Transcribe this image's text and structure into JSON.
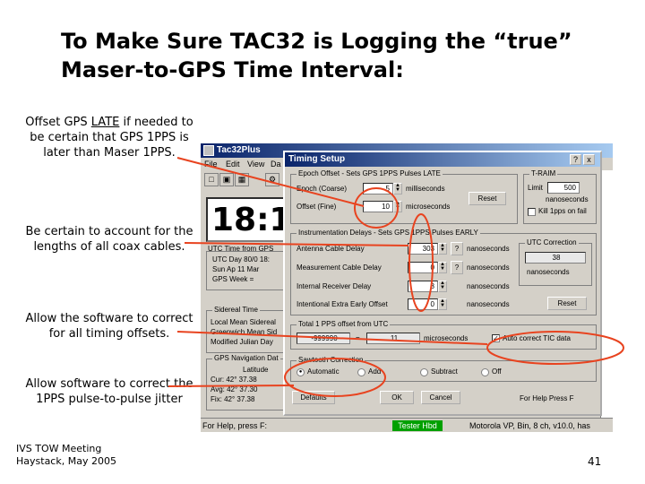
{
  "slide": {
    "title_line1": "To Make Sure TAC32 is Logging the “true”",
    "title_line2": "Maser-to-GPS Time Interval:",
    "note1": {
      "before": "Offset GPS ",
      "underlined": "LATE",
      "after": " if needed to be certain that GPS 1PPS is later than Maser 1PPS."
    },
    "note2": "Be certain to account for the lengths of all coax cables.",
    "note3": "Allow the software to correct for all timing offsets.",
    "note4": "Allow software to correct the 1PPS pulse-to-pulse jitter",
    "footer_line1": "IVS TOW Meeting",
    "footer_line2": "Haystack, May 2005",
    "page_number": "41"
  },
  "app": {
    "title": "Tac32Plus",
    "menu": [
      "File",
      "Edit",
      "View",
      "Da"
    ],
    "clock": "18:1",
    "utc_label": "UTC Time from GPS",
    "utc_lines": [
      "UTC Day 80/0 18:",
      "Sun Ap 11 Mar",
      "GPS Week ="
    ],
    "sidereal_title": "Sidereal Time",
    "sidereal_lines": [
      "Local Mean Sidereal",
      "Greenwich Mean Sid",
      "Modified Julian Day"
    ],
    "gps_nav_title": "GPS Navigation Dat",
    "gps_nav_lines": [
      "Latitude",
      "Cur:   42° 37.38",
      "Avg:   42° 37.30",
      "Fix:   42° 37.38"
    ],
    "status_help": "For Help, press F:",
    "status_green": "Tester Hbd",
    "status_right": "Motorola VP, Bin, 8 ch, v10.0, has",
    "icons": {
      "app": "window-icon",
      "new": "new-document-icon",
      "open": "folder-icon",
      "save": "save-icon",
      "settings": "gear-icon"
    }
  },
  "dialog": {
    "title": "Timing Setup",
    "help_btn": "?",
    "close_btn": "x",
    "epoch_group": "Epoch Offset - Sets GPS 1PPS Pulses LATE",
    "coarse_label": "Epoch (Coarse)",
    "coarse_value": "5",
    "coarse_unit": "milliseconds",
    "fine_label": "Offset (Fine)",
    "fine_value": "10",
    "fine_unit": "microseconds",
    "reset_label": "Reset",
    "tdaim_group": "T-RAIM",
    "limit_label": "Limit",
    "limit_value": "500",
    "limit_unit": "nanoseconds",
    "kill_label": "Kill 1pps on fail",
    "inst_group": "Instrumentation Delays - Sets GPS 1PPS Pulses EARLY",
    "antenna_label": "Antenna Cable Delay",
    "antenna_value": "303",
    "measurement_label": "Measurement Cable Delay",
    "measurement_value": "0",
    "internal_label": "Internal Receiver Delay",
    "internal_value": "8",
    "intentional_label": "Intentional Extra Early Offset",
    "intentional_value": "0",
    "ns_unit": "nanoseconds",
    "q_btn": "?",
    "reset2_label": "Reset",
    "utc_corr_group": "UTC Correction",
    "utc_corr_value": "38",
    "utc_corr_unit": "nanoseconds",
    "total_group": "Total 1 PPS offset from UTC",
    "total_value": "-999990",
    "total_minus": "=",
    "total_extra": "11",
    "total_unit": "microseconds",
    "auto_correct_label": "Auto correct TIC data",
    "sawtooth_group": "Sawtooth Correction",
    "saw_options": [
      "Automatic",
      "Add",
      "Subtract",
      "Off"
    ],
    "defaults_label": "Defaults",
    "ok_label": "OK",
    "cancel_label": "Cancel",
    "help_text": "For Help Press F"
  },
  "colors": {
    "annotation": "#e8431f",
    "titlebar": "#0a246a",
    "status_green": "#00a000"
  }
}
